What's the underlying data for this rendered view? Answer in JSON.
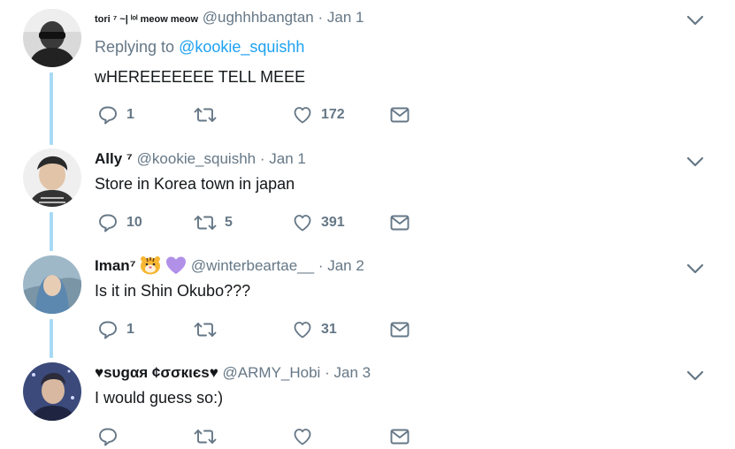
{
  "tweets": [
    {
      "name": "tori ⁷ ~| ˡᵒˡ meow meow",
      "handle": "@ughhhbangtan",
      "date": "Jan 1",
      "reply_prefix": "Replying to",
      "reply_to": "@kookie_squishh",
      "text": "wHEREEEEEEE TELL MEEE",
      "replies": "1",
      "retweets": "",
      "likes": "172"
    },
    {
      "name": "Ally ⁷",
      "handle": "@kookie_squishh",
      "date": "Jan 1",
      "text": "Store in Korea town in japan",
      "replies": "10",
      "retweets": "5",
      "likes": "391"
    },
    {
      "name": "Iman⁷",
      "emojis": [
        "tiger-face-emoji",
        "purple-heart-emoji"
      ],
      "handle": "@winterbeartae__",
      "date": "Jan 2",
      "text": "Is it in Shin Okubo???",
      "replies": "1",
      "retweets": "",
      "likes": "31"
    },
    {
      "name": "♥ѕυgαя ¢σσкιєѕ♥",
      "handle": "@ARMY_Hobi",
      "date": "Jan 3",
      "text": "I would guess so:)",
      "replies": "",
      "retweets": "",
      "likes": ""
    }
  ],
  "colors": {
    "text": "#14171a",
    "muted": "#657786",
    "link": "#1da1f2",
    "thread_line": "#a8daf5"
  },
  "icons": [
    "reply-icon",
    "retweet-icon",
    "like-icon",
    "dm-icon",
    "chevron-down-icon"
  ]
}
